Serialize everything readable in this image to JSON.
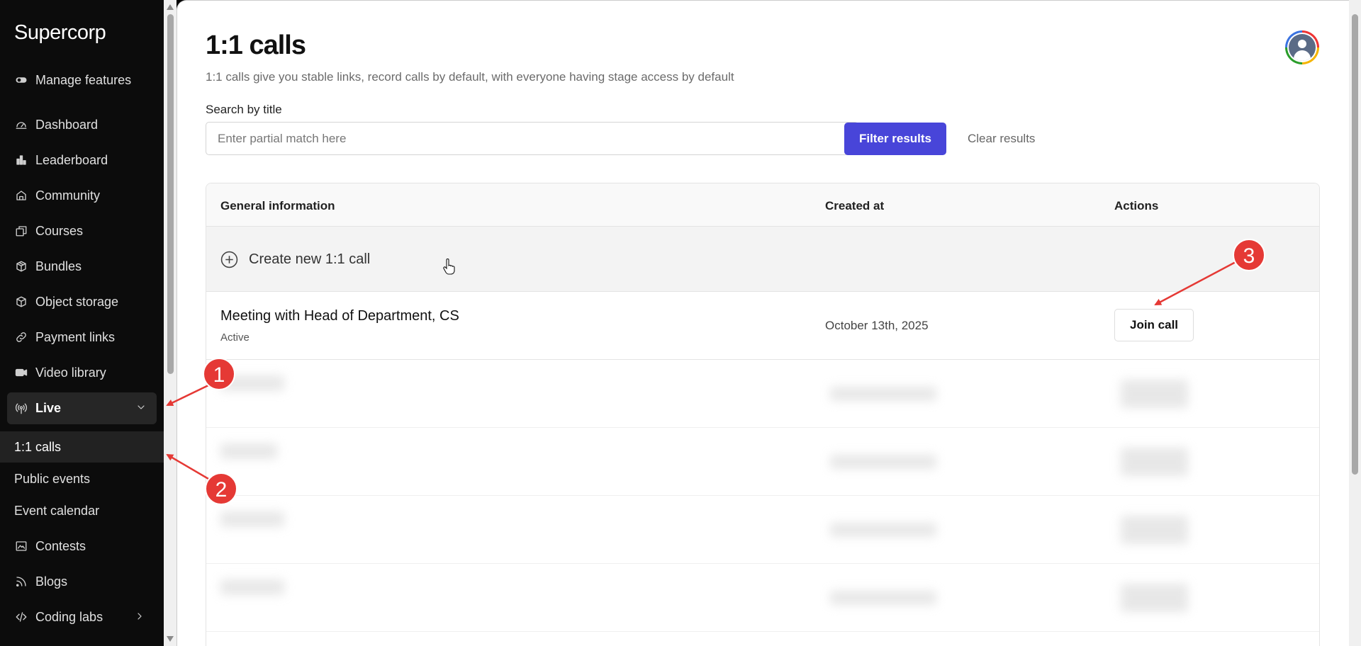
{
  "sidebar": {
    "brand": "Supercorp",
    "manage_features": "Manage features",
    "items": [
      {
        "label": "Dashboard",
        "icon": "dashboard-icon"
      },
      {
        "label": "Leaderboard",
        "icon": "bar-chart-icon"
      },
      {
        "label": "Community",
        "icon": "community-icon"
      },
      {
        "label": "Courses",
        "icon": "courses-icon"
      },
      {
        "label": "Bundles",
        "icon": "bundle-icon"
      },
      {
        "label": "Object storage",
        "icon": "box-icon"
      },
      {
        "label": "Payment links",
        "icon": "link-icon"
      },
      {
        "label": "Video library",
        "icon": "video-icon"
      }
    ],
    "live": {
      "label": "Live",
      "icon": "broadcast-icon",
      "expanded": true,
      "children": [
        "1:1 calls",
        "Public events",
        "Event calendar"
      ],
      "active_child": "1:1 calls"
    },
    "after_items": [
      {
        "label": "Contests",
        "icon": "image-icon"
      },
      {
        "label": "Blogs",
        "icon": "rss-icon"
      },
      {
        "label": "Coding labs",
        "icon": "code-icon"
      }
    ]
  },
  "main": {
    "title": "1:1 calls",
    "subtitle": "1:1 calls give you stable links, record calls by default, with everyone having stage access by default",
    "search": {
      "label": "Search by title",
      "placeholder": "Enter partial match here",
      "value": ""
    },
    "filter_button": "Filter results",
    "clear_button": "Clear results",
    "table": {
      "columns": [
        "General information",
        "Created at",
        "Actions"
      ],
      "create_label": "Create new 1:1 call",
      "rows": [
        {
          "title": "Meeting with Head of Department, CS",
          "status": "Active",
          "created_at": "October 13th, 2025",
          "action": "Join call"
        }
      ]
    }
  },
  "annotations": [
    "1",
    "2",
    "3"
  ],
  "colors": {
    "accent": "#4845d9",
    "sidebar_bg": "#0c0c0c",
    "annotation_red": "#e53935"
  }
}
